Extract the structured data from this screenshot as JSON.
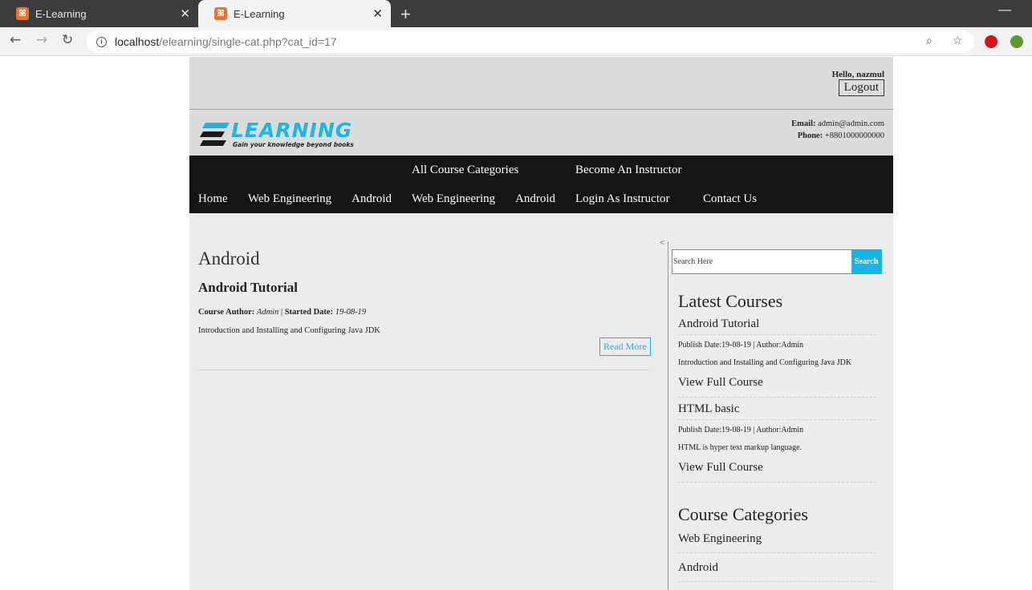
{
  "browser": {
    "tabs": [
      {
        "title": "E-Learning",
        "favicon": "xampp-icon"
      },
      {
        "title": "E-Learning",
        "favicon": "xampp-icon"
      }
    ],
    "url_host": "localhost",
    "url_path": "/elearning/single-cat.php?cat_id=17"
  },
  "header": {
    "greeting": "Hello, nazmul",
    "logout_label": "Logout",
    "logo_text": "LEARNING",
    "logo_tagline": "Gain your knowledge beyond books",
    "email_label": "Email:",
    "email_value": "admin@admin.com",
    "phone_label": "Phone:",
    "phone_value": "+8801000000000"
  },
  "nav": {
    "row1": [
      "All Course Categories",
      "Become An Instructor"
    ],
    "row2": [
      "Home",
      "Web Engineering",
      "Android",
      "Web Engineering",
      "Android",
      "Login As Instructor",
      "Contact Us"
    ]
  },
  "main": {
    "category_title": "Android",
    "stray_char": "<",
    "post": {
      "title": "Android Tutorial",
      "author_label": "Course Author:",
      "author": "Admin",
      "separator": "|",
      "date_label": "Started Date:",
      "date": "19-08-19",
      "excerpt": "Introduction and Installing and Configuring Java JDK",
      "read_more": "Read More"
    }
  },
  "sidebar": {
    "search_placeholder": "Search Here",
    "search_button": "Search",
    "latest_heading": "Latest Courses",
    "courses": [
      {
        "title": "Android Tutorial",
        "meta": "Publish Date:19-08-19 | Author:Admin",
        "desc": "Introduction and Installing and Configuring Java JDK",
        "link": "View Full Course"
      },
      {
        "title": "HTML basic",
        "meta": "Publish Date:19-08-19 | Author:Admin",
        "desc": "HTML is hyper text markup language.",
        "link": "View Full Course"
      }
    ],
    "categories_heading": "Course Categories",
    "categories": [
      "Web Engineering",
      "Android"
    ]
  },
  "colors": {
    "accent": "#17b4e6",
    "menu_bg": "#151515",
    "header_bg": "#dcdcdc",
    "page_bg": "#ececec"
  }
}
